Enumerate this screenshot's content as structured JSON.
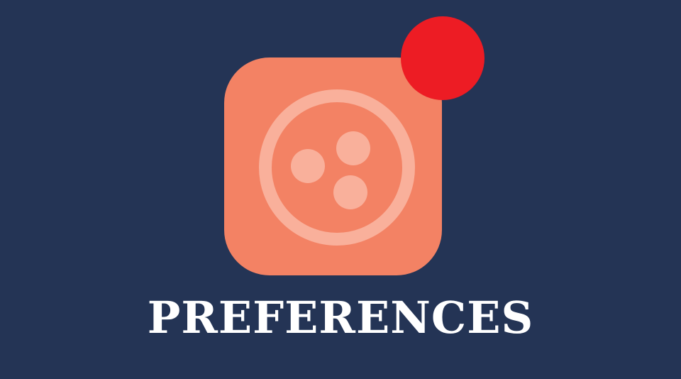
{
  "app": {
    "title": "PREFERENCES",
    "icon": "preferences-app-icon",
    "glyph": "three-dots-circle-icon",
    "badge": "notification-dot",
    "colors": {
      "background": "#243455",
      "icon_tile": "#f38264",
      "icon_glyph": "#f9b09b",
      "badge": "#ed1c24",
      "title_text": "#ffffff"
    }
  }
}
